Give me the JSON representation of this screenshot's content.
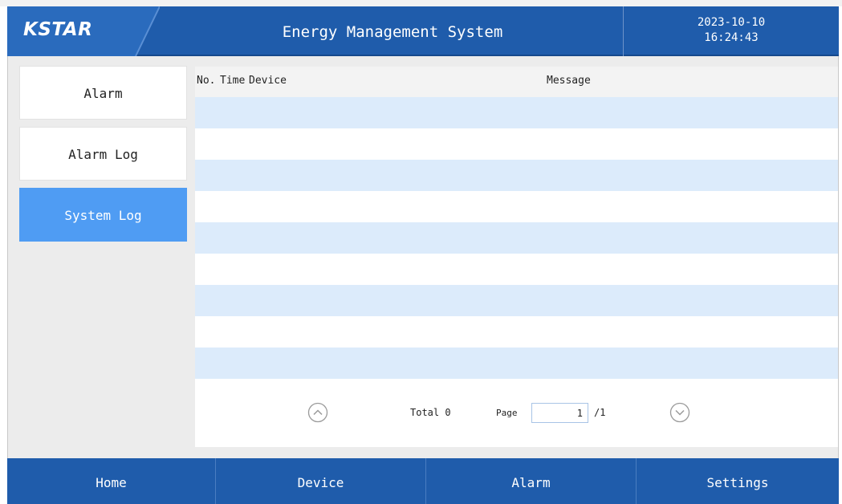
{
  "header": {
    "logo": "KSTAR",
    "title": "Energy Management System",
    "date": "2023-10-10",
    "time": "16:24:43"
  },
  "sidebar": {
    "items": [
      {
        "label": "Alarm",
        "active": false
      },
      {
        "label": "Alarm Log",
        "active": false
      },
      {
        "label": "System Log",
        "active": true
      }
    ]
  },
  "table": {
    "columns": {
      "no": "No.",
      "time": "Time",
      "device": "Device",
      "message": "Message"
    },
    "rows": []
  },
  "pager": {
    "total": "Total 0",
    "page_label": "Page",
    "page_value": "1",
    "page_total": "/1"
  },
  "nav": {
    "home": "Home",
    "device": "Device",
    "alarm": "Alarm",
    "settings": "Settings"
  },
  "colors": {
    "header_bg": "#1f5cab",
    "active_item": "#4f9cf3",
    "row_stripe": "#dcebfb"
  }
}
